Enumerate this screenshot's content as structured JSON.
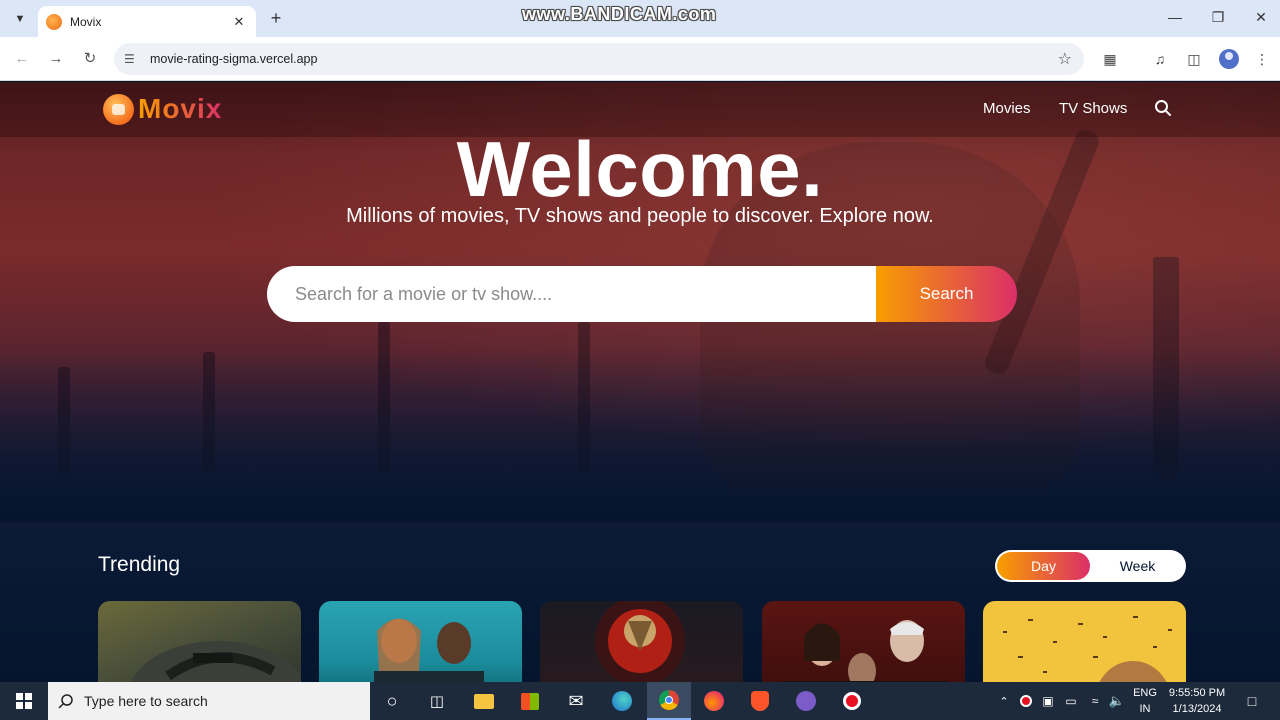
{
  "browser": {
    "tab_title": "Movix",
    "url": "movie-rating-sigma.vercel.app",
    "watermark": "www.BANDICAM.com"
  },
  "site": {
    "logo_text": "Movix",
    "nav": [
      "Movies",
      "TV Shows"
    ],
    "hero_title": "Welcome.",
    "hero_subtitle": "Millions of movies, TV shows and people to discover. Explore now.",
    "search_placeholder": "Search for a movie or tv show....",
    "search_button": "Search",
    "trending_title": "Trending",
    "switch_options": [
      "Day",
      "Week"
    ],
    "switch_active": "Day"
  },
  "taskbar": {
    "search_placeholder": "Type here to search",
    "lang_line1": "ENG",
    "lang_line2": "IN",
    "time": "9:55:50 PM",
    "date": "1/13/2024"
  },
  "colors": {
    "accent_start": "#f89e00",
    "accent_end": "#da2f68",
    "page_bg": "#04152d"
  }
}
